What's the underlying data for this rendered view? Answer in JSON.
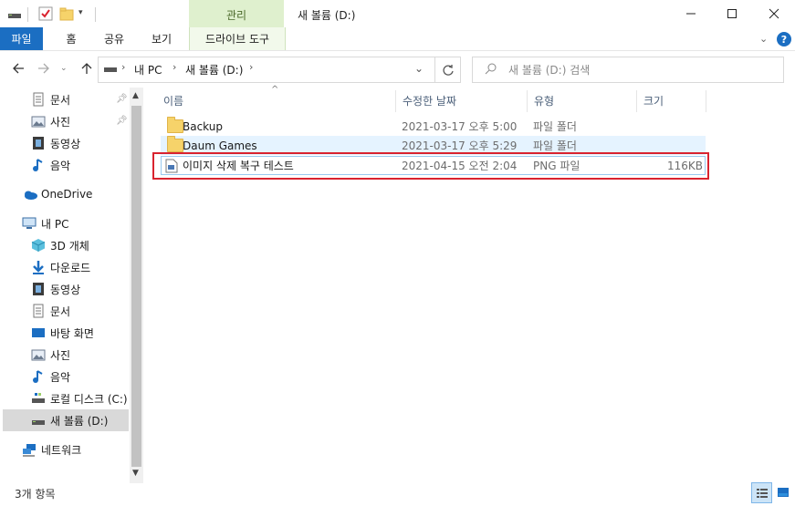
{
  "titlebar": {
    "contextual_tab": "관리",
    "window_title": "새 볼륨 (D:)"
  },
  "ribbon": {
    "tabs": [
      "파일",
      "홈",
      "공유",
      "보기",
      "드라이브 도구"
    ]
  },
  "address": {
    "path": [
      "내 PC",
      "새 볼륨 (D:)"
    ],
    "search_placeholder": "새 볼륨 (D:) 검색"
  },
  "nav": {
    "items": [
      {
        "label": "문서",
        "icon": "documents-icon",
        "pinned": true
      },
      {
        "label": "사진",
        "icon": "pictures-icon",
        "pinned": true
      },
      {
        "label": "동영상",
        "icon": "videos-icon"
      },
      {
        "label": "음악",
        "icon": "music-icon"
      },
      {
        "label": "OneDrive",
        "icon": "onedrive-icon"
      },
      {
        "label": "내 PC",
        "icon": "pc-icon"
      },
      {
        "label": "3D 개체",
        "icon": "3d-objects-icon"
      },
      {
        "label": "다운로드",
        "icon": "downloads-icon"
      },
      {
        "label": "동영상",
        "icon": "videos-icon"
      },
      {
        "label": "문서",
        "icon": "documents-icon"
      },
      {
        "label": "바탕 화면",
        "icon": "desktop-icon"
      },
      {
        "label": "사진",
        "icon": "pictures-icon"
      },
      {
        "label": "음악",
        "icon": "music-icon"
      },
      {
        "label": "로컬 디스크 (C:)",
        "icon": "local-disk-icon"
      },
      {
        "label": "새 볼륨 (D:)",
        "icon": "drive-icon",
        "selected": true
      },
      {
        "label": "네트워크",
        "icon": "network-icon"
      }
    ]
  },
  "columns": {
    "name": "이름",
    "date": "수정한 날짜",
    "type": "유형",
    "size": "크기"
  },
  "files": [
    {
      "name": "Backup",
      "date": "2021-03-17 오후 5:00",
      "type": "파일 폴더",
      "size": "",
      "icon": "folder-icon"
    },
    {
      "name": "Daum Games",
      "date": "2021-03-17 오후 5:29",
      "type": "파일 폴더",
      "size": "",
      "icon": "folder-icon"
    },
    {
      "name": "이미지 삭제 복구 테스트",
      "date": "2021-04-15 오전 2:04",
      "type": "PNG 파일",
      "size": "116KB",
      "icon": "png-file-icon"
    }
  ],
  "status": {
    "item_count": "3개 항목"
  },
  "colors": {
    "file_tab": "#1b6ec2",
    "manage_tab": "#dff0ce",
    "highlight_border": "#d9232f",
    "selected_nav": "#d9d9d9",
    "hover_row": "#e5f3ff"
  }
}
